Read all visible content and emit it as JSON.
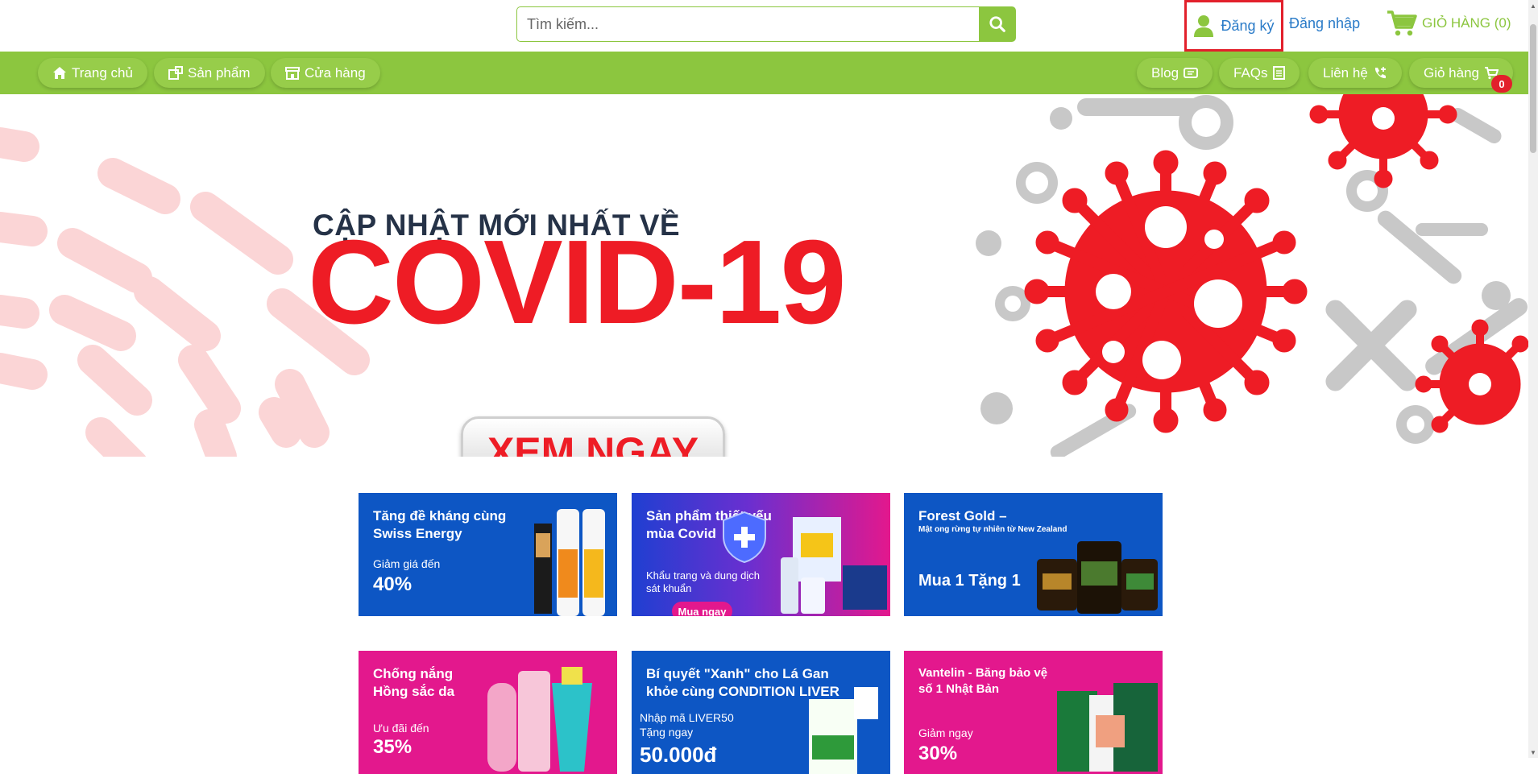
{
  "search": {
    "placeholder": "Tìm kiếm..."
  },
  "auth": {
    "register_label": "Đăng ký",
    "login_label": "Đăng nhập"
  },
  "cart": {
    "top_label": "GIỎ HÀNG (0)",
    "badge_count": "0"
  },
  "nav": {
    "left": [
      {
        "label": "Trang chủ",
        "icon": "home-icon"
      },
      {
        "label": "Sản phẩm",
        "icon": "products-icon"
      },
      {
        "label": "Cửa hàng",
        "icon": "store-icon"
      }
    ],
    "right": [
      {
        "label": "Blog",
        "icon": "blog-icon"
      },
      {
        "label": "FAQs",
        "icon": "faq-icon"
      },
      {
        "label": "Liên hệ",
        "icon": "phone-icon"
      },
      {
        "label": "Giỏ hàng",
        "icon": "cart-icon"
      }
    ]
  },
  "hero": {
    "subtitle": "CẬP NHẬT MỚI NHẤT VỀ",
    "title": "COVID-19",
    "button_label": "XEM NGAY"
  },
  "tiles": [
    {
      "title": "Tăng đề kháng cùng Swiss Energy",
      "small": "Giảm giá đến",
      "big": "40%"
    },
    {
      "title": "Sản phẩm thiết yếu mùa Covid",
      "small": "Khẩu trang và dung dịch sát khuẩn",
      "button": "Mua ngay"
    },
    {
      "title": "Forest Gold –",
      "small": "Mật ong rừng tự nhiên từ New Zealand",
      "big": "Mua 1 Tặng 1"
    },
    {
      "title": "Chống nắng Hồng sắc da",
      "small": "Ưu đãi đến",
      "big": "35%"
    },
    {
      "title": "Bí quyết \"Xanh\" cho Lá Gan khỏe cùng CONDITION LIVER",
      "small": "Nhập mã LIVER50",
      "small2": "Tặng ngay",
      "big": "50.000đ"
    },
    {
      "title": "Vantelin - Băng bảo vệ số 1 Nhật Bản",
      "small": "Giảm ngay",
      "big": "30%"
    }
  ],
  "colors": {
    "brand_green": "#8cc63f",
    "covid_red": "#ee1c25",
    "link_blue": "#2a7bc8",
    "tile_blue": "#0d56c4",
    "tile_pink": "#e3188d"
  }
}
